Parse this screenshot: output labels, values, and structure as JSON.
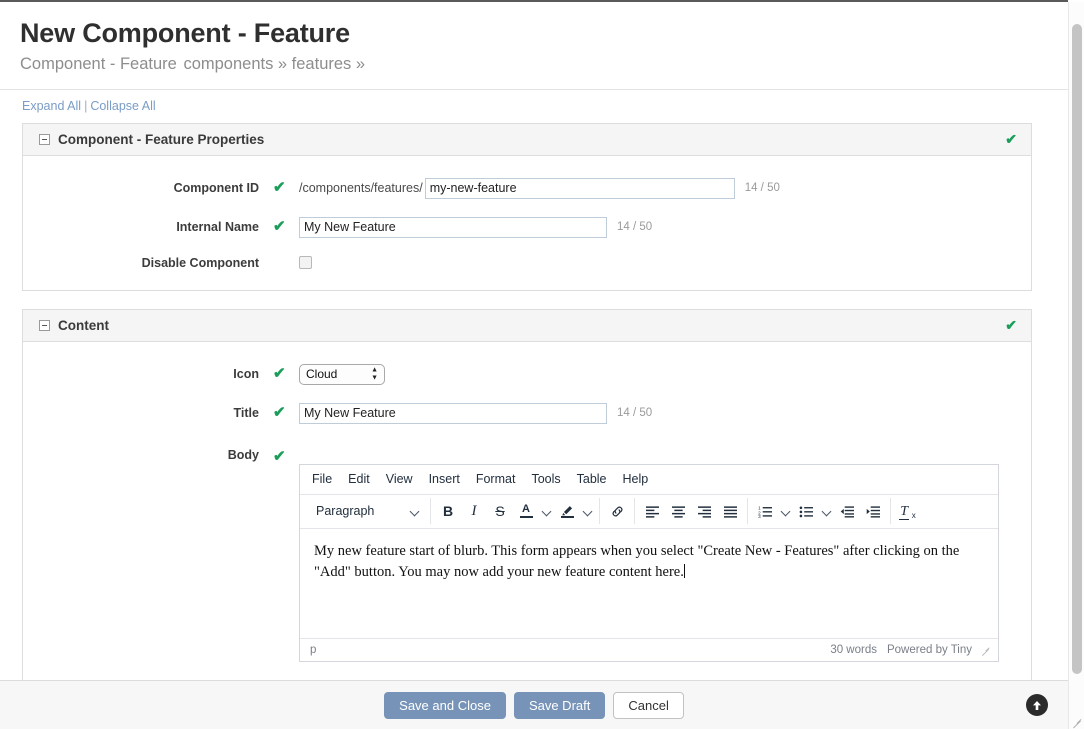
{
  "header": {
    "title": "New Component - Feature",
    "breadcrumb_type": "Component - Feature",
    "breadcrumb_path": "components » features »"
  },
  "toolbar_links": {
    "expand_all": "Expand All",
    "divider": "|",
    "collapse_all": "Collapse All"
  },
  "sections": [
    {
      "title": "Component - Feature Properties",
      "valid_icon": "✔",
      "fields": [
        {
          "label": "Component ID",
          "check": "✔",
          "prefix": "/components/features/",
          "value": "my-new-feature",
          "counter": "14 / 50"
        },
        {
          "label": "Internal Name",
          "check": "✔",
          "value": "My New Feature",
          "counter": "14 / 50"
        },
        {
          "label": "Disable Component",
          "checkbox_checked": false
        }
      ]
    },
    {
      "title": "Content",
      "valid_icon": "✔",
      "fields": [
        {
          "label": "Icon",
          "check": "✔",
          "select_value": "Cloud",
          "options": [
            "Cloud"
          ]
        },
        {
          "label": "Title",
          "check": "✔",
          "value": "My New Feature",
          "counter": "14 / 50"
        },
        {
          "label": "Body",
          "check": "✔"
        }
      ]
    }
  ],
  "editor": {
    "menubar": [
      "File",
      "Edit",
      "View",
      "Insert",
      "Format",
      "Tools",
      "Table",
      "Help"
    ],
    "format_label": "Paragraph",
    "buttons": [
      "bold",
      "italic",
      "strikethrough",
      "text-color",
      "background-color",
      "link",
      "align-left",
      "align-center",
      "align-right",
      "align-justify",
      "numbered-list",
      "bulleted-list",
      "outdent",
      "indent",
      "clear-formatting"
    ],
    "body_text": "My new feature start of blurb.  This form appears when you select \"Create New - Features\" after clicking on the \"Add\" button.  You may now add your new feature content here.",
    "status": {
      "path": "p",
      "word_count": "30 words",
      "brand": "Powered by Tiny"
    }
  },
  "footer": {
    "save_and_close": "Save and Close",
    "save_draft": "Save Draft",
    "cancel": "Cancel",
    "to_top_icon": "⬆"
  },
  "colors": {
    "accent_green": "#1a9e5a",
    "primary_button": "#7794b8",
    "link": "#7a9cc6",
    "panel_head": "#f5f5f5"
  }
}
